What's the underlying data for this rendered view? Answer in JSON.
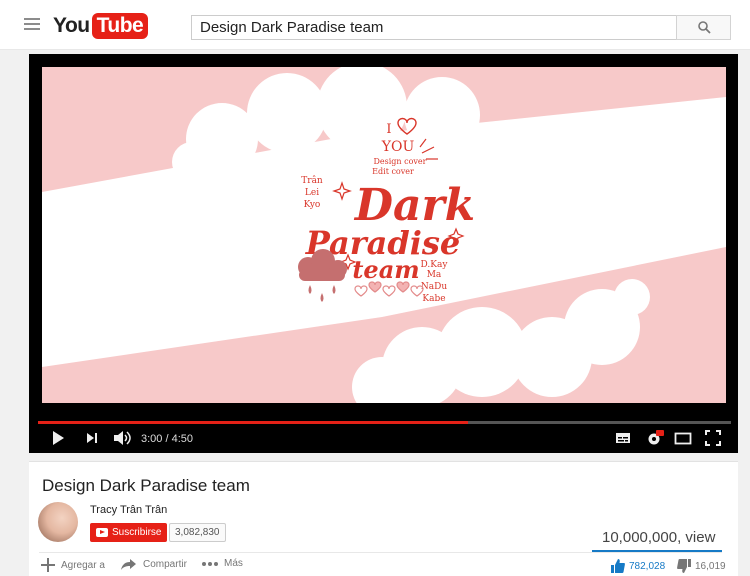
{
  "masthead": {
    "logo_you": "You",
    "logo_tube": "Tube",
    "search_value": "Design Dark Paradise team"
  },
  "player": {
    "time": "3:00 / 4:50",
    "progress_fraction": 0.62,
    "artwork": {
      "text_i": "I",
      "text_you": "YOU",
      "text_design_cover": "Design cover",
      "text_edit_cover": "Edit cover",
      "text_tran": "Trân",
      "text_lei": "Lei",
      "text_kyo": "Kyo",
      "text_dark": "Dark",
      "text_paradise": "Paradise",
      "text_team": "team",
      "text_dkay": "D.Kay",
      "text_ma": "Ma",
      "text_nadu": "NaDu",
      "text_kabe": "Kabe"
    }
  },
  "video": {
    "title": "Design Dark Paradise team",
    "channel": "Tracy Trân Trân",
    "subscribe_label": "Suscribirse",
    "subscriber_count": "3,082,830",
    "views": "10,000,000, view",
    "actions": {
      "add_to": "Agregar a",
      "share": "Compartir",
      "more": "Más"
    },
    "likes": "782,028",
    "dislikes": "16,019"
  },
  "colors": {
    "brand_red": "#e62117",
    "accent_blue": "#167ac6",
    "art_pink": "#f7c9c9",
    "art_red": "#d9362a"
  },
  "icons": [
    "menu-icon",
    "search-icon",
    "play-icon",
    "next-icon",
    "volume-icon",
    "subtitles-icon",
    "settings-icon",
    "theater-icon",
    "fullscreen-icon",
    "add-icon",
    "share-icon",
    "more-icon",
    "like-icon",
    "dislike-icon"
  ]
}
